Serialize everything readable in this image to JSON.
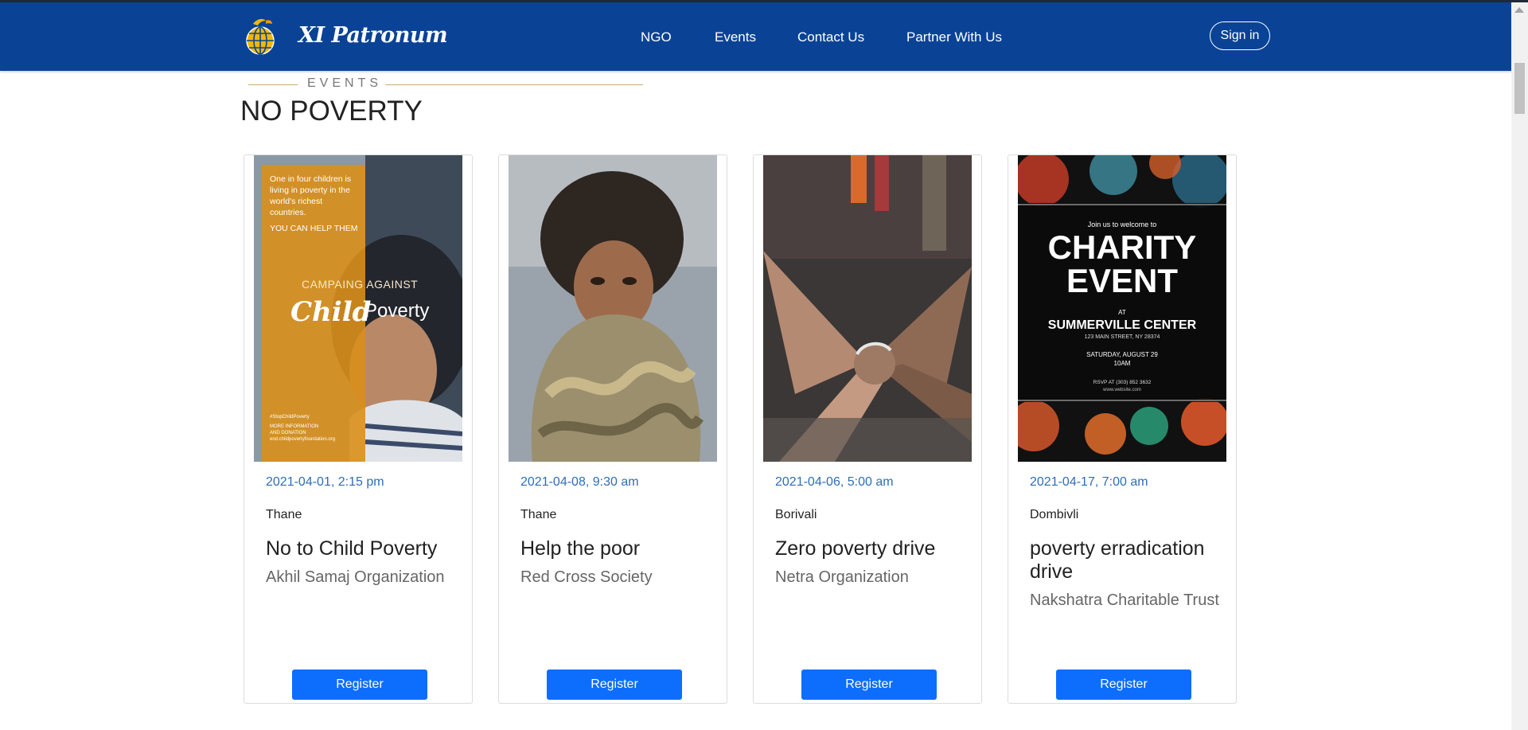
{
  "brand": {
    "name": "XI Patronum"
  },
  "nav": {
    "items": [
      "NGO",
      "Events",
      "Contact Us",
      "Partner With Us"
    ],
    "signin": "Sign in"
  },
  "section": {
    "label": "EVENTS",
    "title": "NO POVERTY"
  },
  "events": [
    {
      "datetime": "2021-04-01, 2:15 pm",
      "location": "Thane",
      "title": "No to Child Poverty",
      "organization": "Akhil Samaj Organization",
      "register": "Register",
      "poster": {
        "text": "One in four children is living in poverty in the world's richest countries.",
        "cta": "YOU CAN HELP THEM",
        "campaign": "CAMPAING AGAINST",
        "word1": "Child",
        "word2": "Poverty",
        "tag": "#StopChildPoverty",
        "foot1": "MORE INFORMATION",
        "foot2": "AND DONATION",
        "foot3": "end.childpovertyfoundation.org"
      }
    },
    {
      "datetime": "2021-04-08, 9:30 am",
      "location": "Thane",
      "title": "Help the poor",
      "organization": "Red Cross Society",
      "register": "Register"
    },
    {
      "datetime": "2021-04-06, 5:00 am",
      "location": "Borivali",
      "title": "Zero poverty drive",
      "organization": "Netra Organization",
      "register": "Register"
    },
    {
      "datetime": "2021-04-17, 7:00 am",
      "location": "Dombivli",
      "title": "poverty erradication drive",
      "organization": "Nakshatra Charitable Trust",
      "register": "Register",
      "poster": {
        "intro": "Join us to welcome to",
        "line1": "CHARITY",
        "line2": "EVENT",
        "at": "AT",
        "venue": "SUMMERVILLE CENTER",
        "address": "123 MAIN STREET, NY 28374",
        "date": "SATURDAY, AUGUST 29",
        "time": "10AM",
        "rsvp": "RSVP AT (303) 852 3632",
        "site": "www.website.com"
      }
    }
  ],
  "colors": {
    "navbar": "#0a4396",
    "accent_line": "#c8a97e",
    "date": "#2f6db5",
    "button": "#0d6efd"
  }
}
